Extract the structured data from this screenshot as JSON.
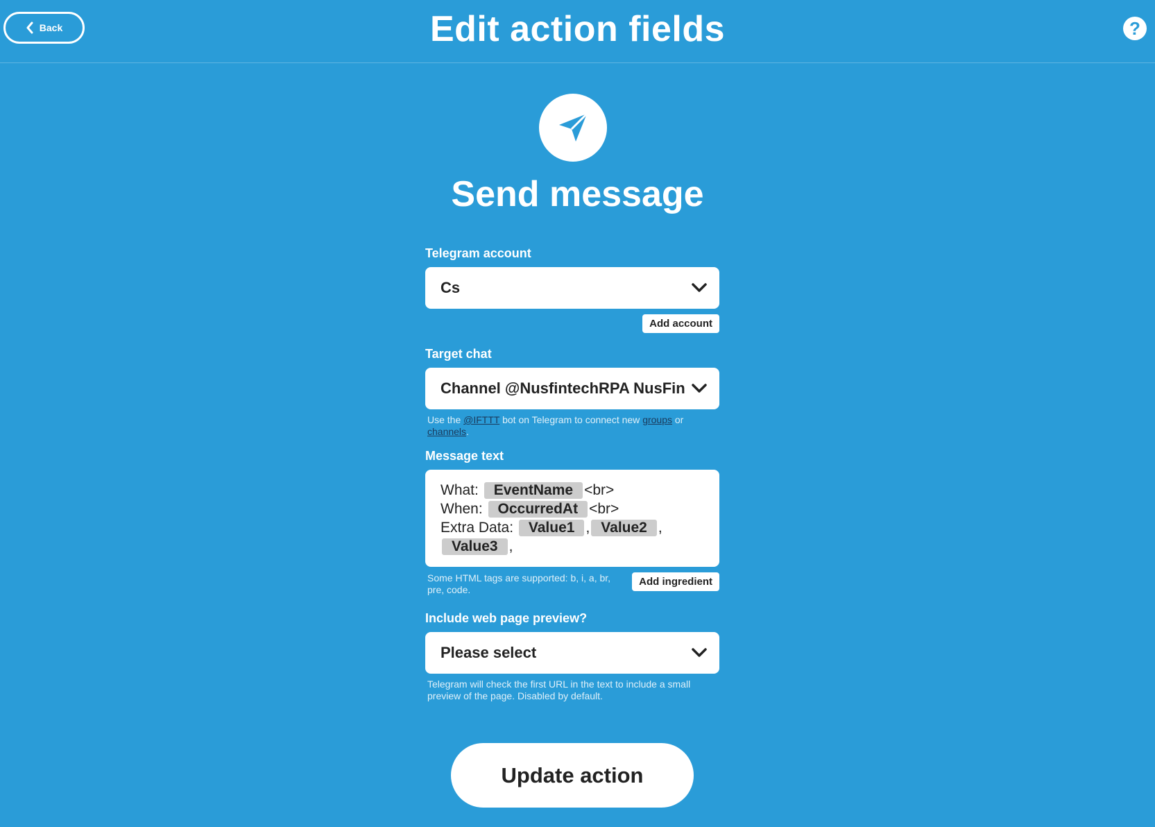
{
  "header": {
    "back_label": "Back",
    "title": "Edit action fields",
    "help_symbol": "?"
  },
  "service": {
    "icon": "telegram-paper-plane-icon",
    "action_title": "Send message"
  },
  "fields": {
    "account": {
      "label": "Telegram account",
      "value": "Cs",
      "add_button": "Add account"
    },
    "target_chat": {
      "label": "Target chat",
      "value": "Channel @NusfintechRPA NusFintech",
      "helper_prefix": "Use the ",
      "helper_link1": "@IFTTT",
      "helper_middle": " bot on Telegram to connect new ",
      "helper_link2": "groups",
      "helper_or": " or ",
      "helper_link3": "channels",
      "helper_end": "."
    },
    "message": {
      "label": "Message text",
      "line1_prefix": "What: ",
      "ingredient1": "EventName",
      "line1_suffix": "<br>",
      "line2_prefix": "When: ",
      "ingredient2": "OccurredAt",
      "line2_suffix": "<br>",
      "line3_prefix": "Extra Data: ",
      "ingredient3": "Value1",
      "sep1": ",",
      "ingredient4": "Value2",
      "sep2": ",",
      "ingredient5": "Value3",
      "sep3": ",",
      "helper": "Some HTML tags are supported: b, i, a, br, pre, code.",
      "add_button": "Add ingredient"
    },
    "preview": {
      "label": "Include web page preview?",
      "value": "Please select",
      "helper": "Telegram will check the first URL in the text to include a small preview of the page. Disabled by default."
    }
  },
  "submit_label": "Update action",
  "colors": {
    "background": "#2a9cd8",
    "pill": "#cccccc"
  }
}
